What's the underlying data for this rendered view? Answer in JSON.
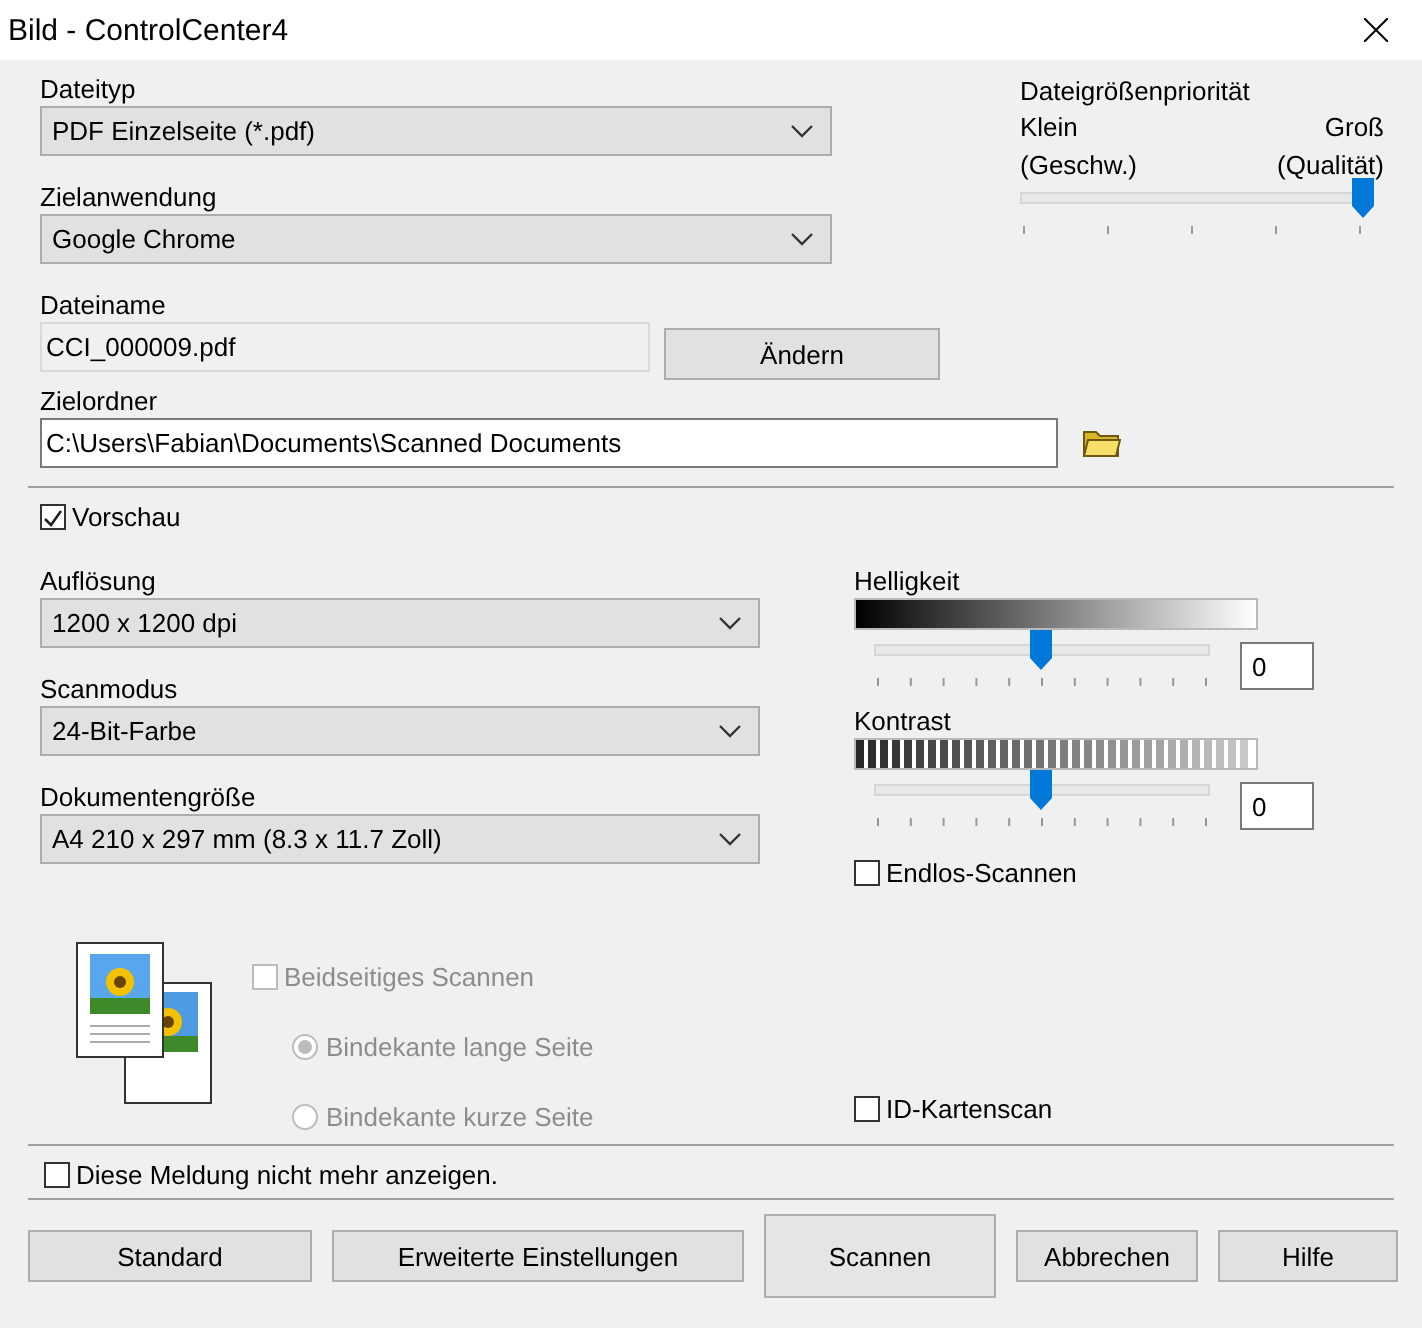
{
  "window": {
    "title": "Bild - ControlCenter4"
  },
  "file_type": {
    "label": "Dateityp",
    "value": "PDF Einzelseite (*.pdf)"
  },
  "target_app": {
    "label": "Zielanwendung",
    "value": "Google Chrome"
  },
  "file_name": {
    "label": "Dateiname",
    "value": "CCI_000009.pdf",
    "button": "Ändern"
  },
  "target_folder": {
    "label": "Zielordner",
    "value": "C:\\Users\\Fabian\\Documents\\Scanned Documents"
  },
  "file_size_priority": {
    "label": "Dateigrößenpriorität",
    "min_label": "Klein",
    "max_label": "Groß",
    "min_note": "(Geschw.)",
    "max_note": "(Qualität)",
    "level": 1
  },
  "preview": {
    "label": "Vorschau",
    "checked": true
  },
  "resolution": {
    "label": "Auflösung",
    "value": "1200 x 1200 dpi"
  },
  "scan_mode": {
    "label": "Scanmodus",
    "value": "24-Bit-Farbe"
  },
  "document_size": {
    "label": "Dokumentengröße",
    "value": "A4 210 x 297 mm (8.3 x 11.7 Zoll)"
  },
  "brightness": {
    "label": "Helligkeit",
    "level": 0.5,
    "value": "0"
  },
  "contrast": {
    "label": "Kontrast",
    "level": 0.5,
    "value": "0"
  },
  "continuous_scan": {
    "label": "Endlos-Scannen",
    "checked": false
  },
  "duplex": {
    "label": "Beidseitiges Scannen",
    "checked": false,
    "disabled": true,
    "options": [
      {
        "label": "Bindekante lange Seite",
        "selected": true
      },
      {
        "label": "Bindekante kurze Seite",
        "selected": false
      }
    ]
  },
  "id_card_scan": {
    "label": "ID-Kartenscan",
    "checked": false
  },
  "dont_show_again": {
    "label": "Diese Meldung nicht mehr anzeigen.",
    "checked": false
  },
  "buttons": [
    {
      "label": "Standard",
      "default": false
    },
    {
      "label": "Erweiterte Einstellungen",
      "default": false
    },
    {
      "label": "Scannen",
      "default": true
    },
    {
      "label": "Abbrechen",
      "default": false
    },
    {
      "label": "Hilfe",
      "default": false
    }
  ]
}
